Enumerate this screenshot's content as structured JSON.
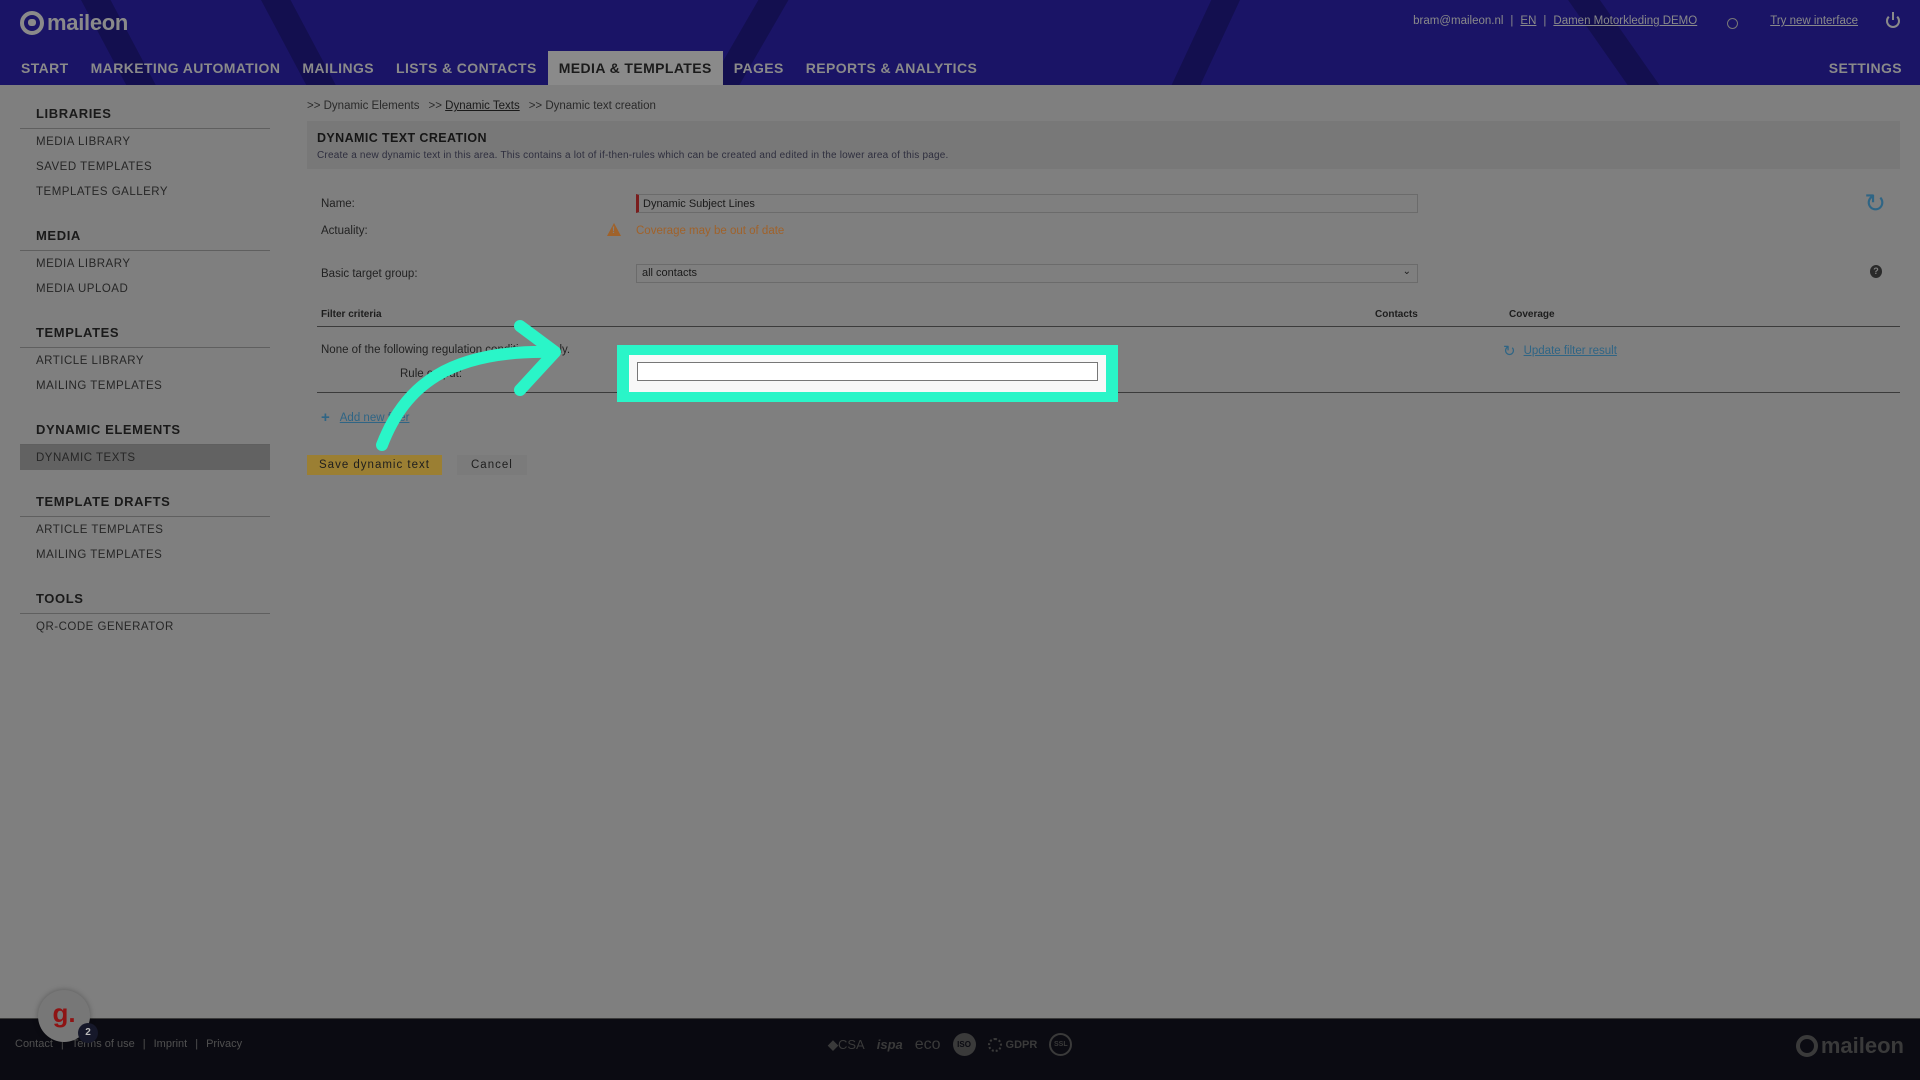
{
  "header": {
    "logo_text": "maileon",
    "user_email": "bram@maileon.nl",
    "language": "EN",
    "account": "Damen Motorkleding DEMO",
    "try_new_interface": "Try new interface",
    "nav": [
      {
        "label": "START",
        "active": false
      },
      {
        "label": "MARKETING AUTOMATION",
        "active": false
      },
      {
        "label": "MAILINGS",
        "active": false
      },
      {
        "label": "LISTS & CONTACTS",
        "active": false
      },
      {
        "label": "MEDIA & TEMPLATES",
        "active": true
      },
      {
        "label": "PAGES",
        "active": false
      },
      {
        "label": "REPORTS & ANALYTICS",
        "active": false
      }
    ],
    "settings_label": "SETTINGS"
  },
  "sidebar": {
    "groups": [
      {
        "title": "LIBRARIES",
        "items": [
          "MEDIA LIBRARY",
          "SAVED TEMPLATES",
          "TEMPLATES GALLERY"
        ]
      },
      {
        "title": "MEDIA",
        "items": [
          "MEDIA LIBRARY",
          "MEDIA UPLOAD"
        ]
      },
      {
        "title": "TEMPLATES",
        "items": [
          "ARTICLE LIBRARY",
          "MAILING TEMPLATES"
        ]
      },
      {
        "title": "DYNAMIC ELEMENTS",
        "items": [
          "DYNAMIC TEXTS"
        ]
      },
      {
        "title": "TEMPLATE DRAFTS",
        "items": [
          "ARTICLE TEMPLATES",
          "MAILING TEMPLATES"
        ]
      },
      {
        "title": "TOOLS",
        "items": [
          "QR-CODE GENERATOR"
        ]
      }
    ],
    "active_item": "DYNAMIC TEXTS"
  },
  "breadcrumb": [
    {
      "label": ">> Dynamic Elements",
      "link": false
    },
    {
      "label": "Dynamic Texts",
      "prefix": ">>",
      "link": true
    },
    {
      "label": ">> Dynamic text creation",
      "link": false
    }
  ],
  "page": {
    "title": "DYNAMIC TEXT CREATION",
    "description": "Create a new dynamic text in this area. This contains a lot of if-then-rules which can be created and edited in the lower area of this page."
  },
  "form": {
    "name_label": "Name:",
    "name_value": "Dynamic Subject Lines",
    "actuality_label": "Actuality:",
    "actuality_warning": "Coverage may be out of date",
    "target_group_label": "Basic target group:",
    "target_group_value": "all contacts"
  },
  "filter": {
    "columns": [
      "Filter criteria",
      "Contacts",
      "Coverage"
    ],
    "condition_text": "None of the following regulation conditions apply.",
    "rule_input_label": "Rule output:",
    "rule_input_value": "",
    "update_link": "Update filter result",
    "add_filter": "Add new filter"
  },
  "buttons": {
    "save": "Save dynamic text",
    "cancel": "Cancel"
  },
  "footer": {
    "links": [
      "Contact",
      "Terms of use",
      "Imprint",
      "Privacy"
    ],
    "badges": [
      "CSA",
      "ispa",
      "eco",
      "ISO",
      "GDPR",
      "SSL"
    ],
    "logo_text": "maileon"
  },
  "widget": {
    "letter": "g.",
    "count": "2"
  },
  "colors": {
    "header_bg": "#1a1466",
    "highlight": "#2af5c8",
    "link": "#2f6585",
    "warning": "#a0622a",
    "save_button": "#9b7f33"
  }
}
